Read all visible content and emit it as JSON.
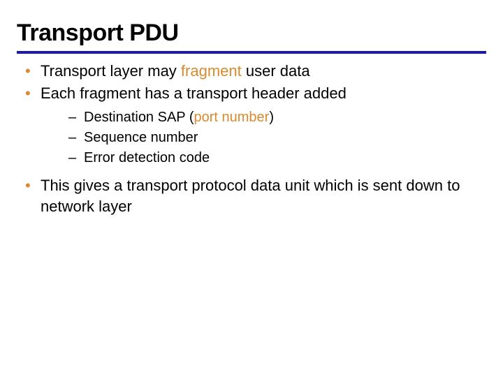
{
  "title": "Transport PDU",
  "bullets": {
    "b0": {
      "pre": "Transport layer may ",
      "hi": "fragment",
      "post": " user data"
    },
    "b1": "Each fragment has a transport header added",
    "sub": {
      "s0": {
        "pre": "Destination SAP (",
        "hi": "port number",
        "post": ")"
      },
      "s1": "Sequence number",
      "s2": "Error detection code"
    },
    "b2": "This gives a transport protocol data unit which is sent down to network layer"
  }
}
